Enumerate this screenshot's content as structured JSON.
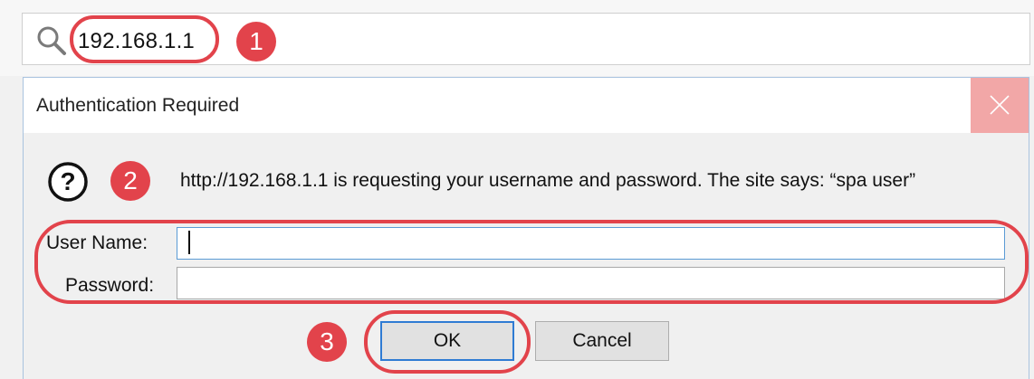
{
  "browser": {
    "address": "192.168.1.1"
  },
  "dialog": {
    "title": "Authentication Required",
    "message": "http://192.168.1.1 is requesting your username and password. The site says: “spa user”",
    "username_label": "User Name:",
    "username_value": "",
    "password_label": "Password:",
    "password_value": "",
    "ok_label": "OK",
    "cancel_label": "Cancel"
  },
  "annotations": {
    "step1": "1",
    "step2": "2",
    "step3": "3",
    "highlight_color": "#e2434b"
  },
  "icons": {
    "search": "search-icon",
    "close": "close-icon",
    "question": "question-icon"
  }
}
